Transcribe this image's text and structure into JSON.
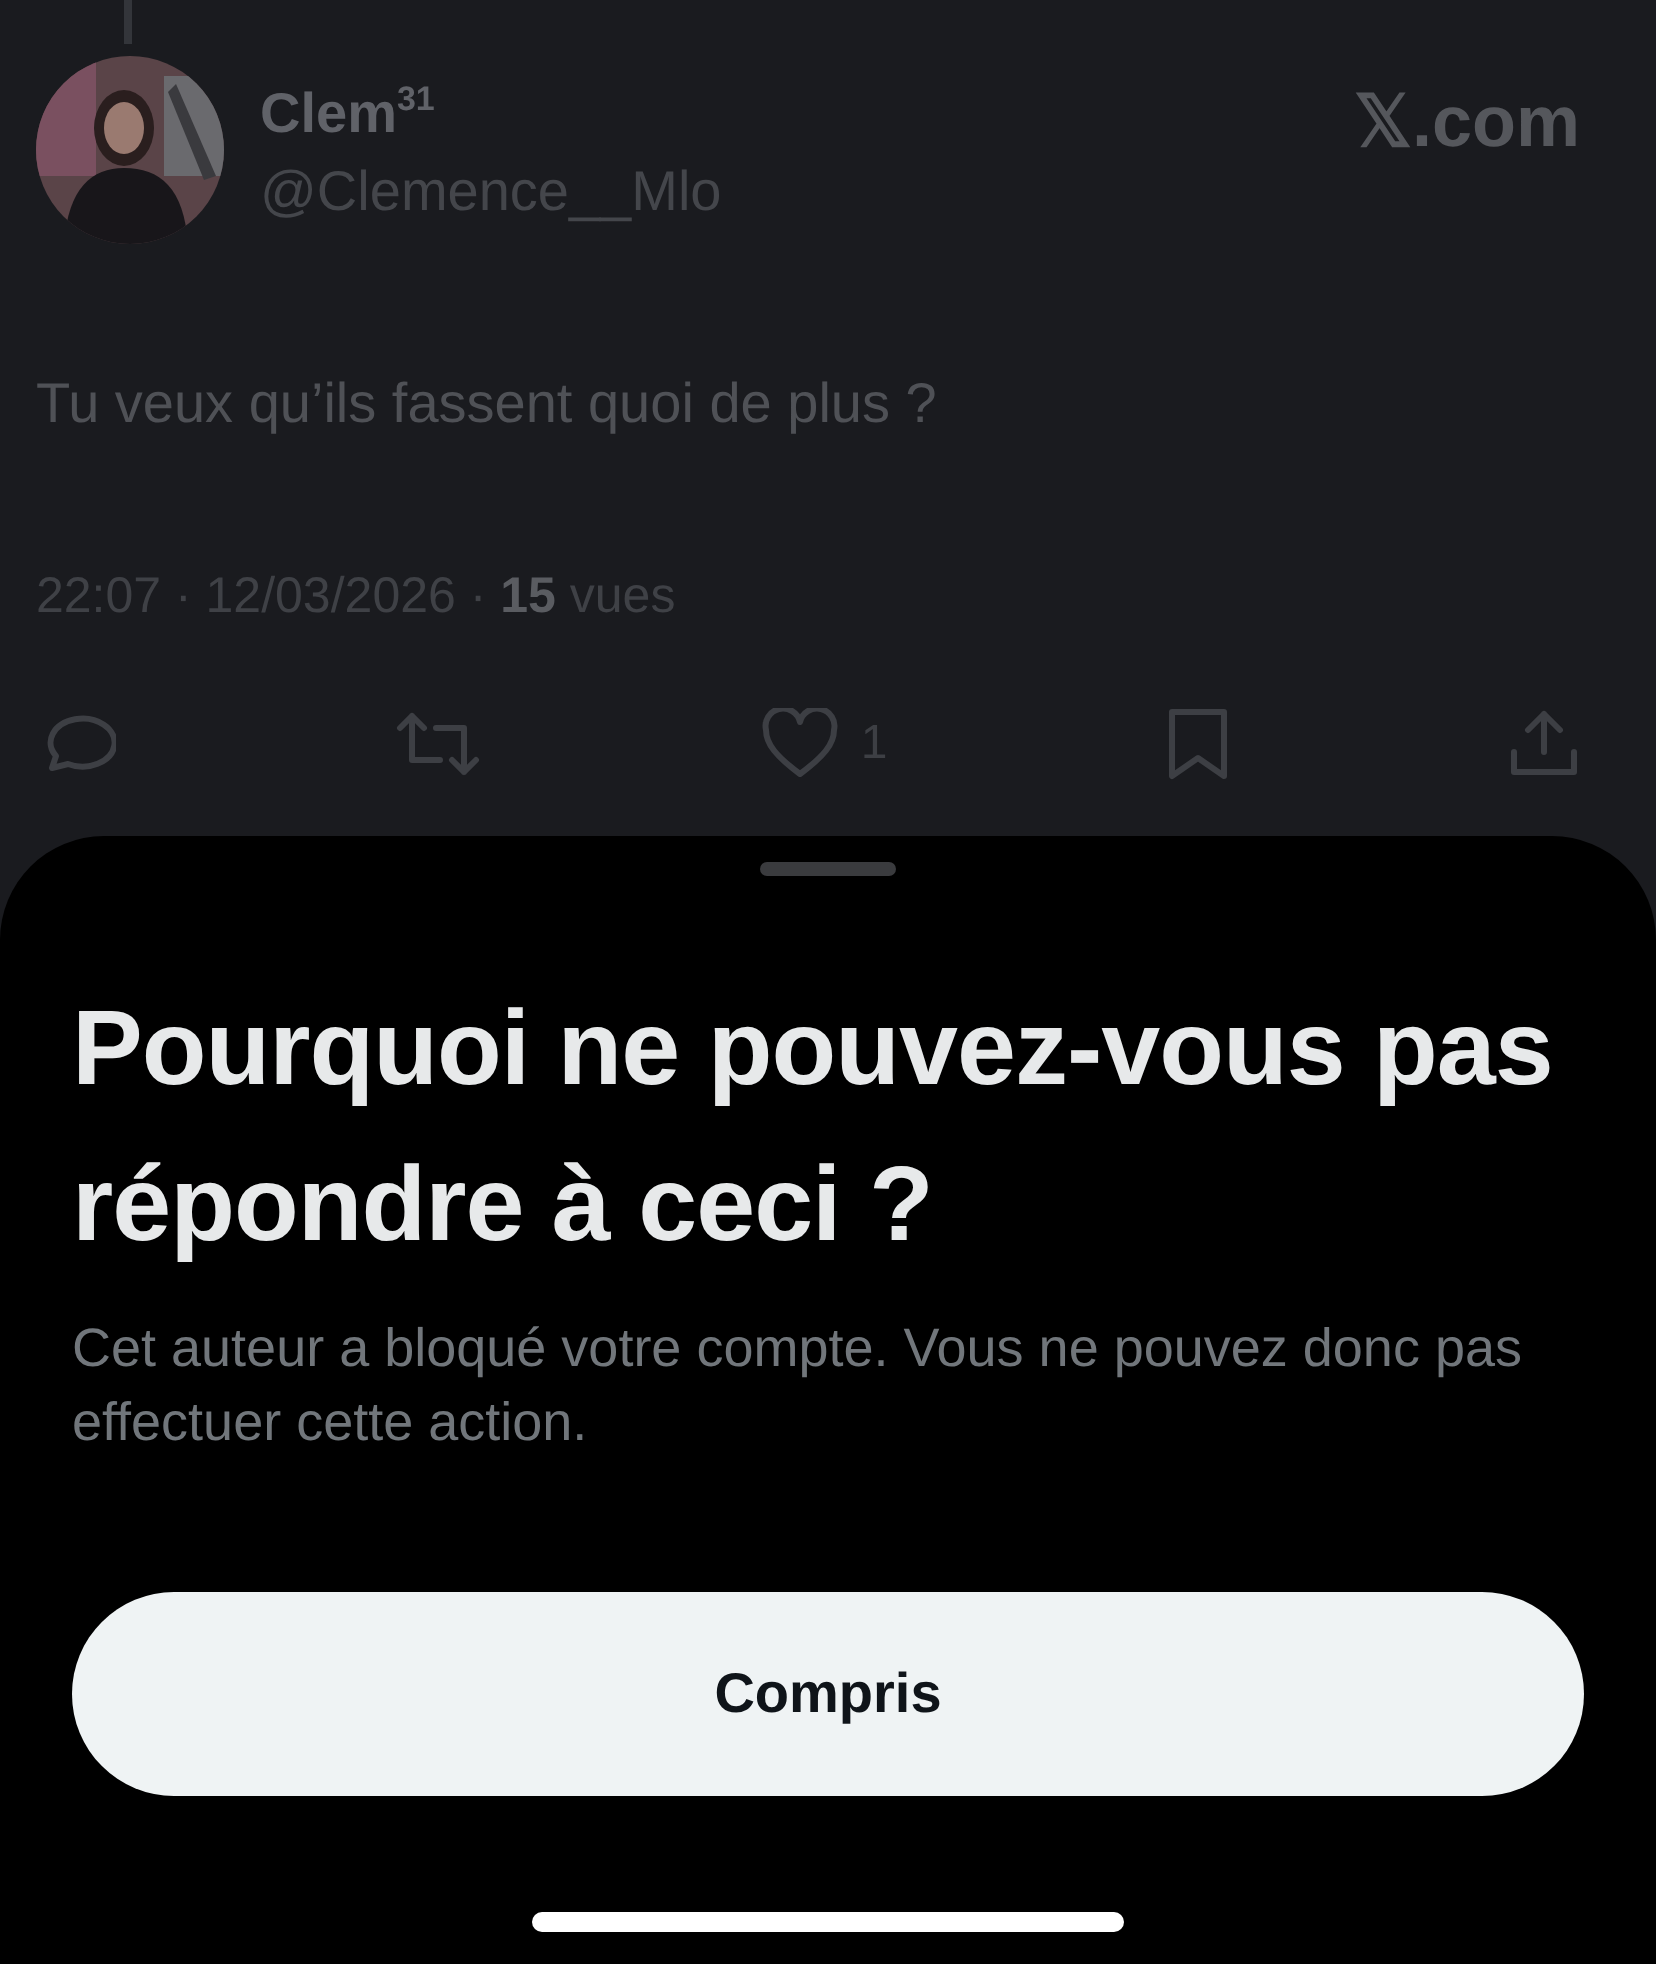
{
  "tweet": {
    "name": "Clem$^{31}$",
    "handle": "@Clemence__Mlo",
    "source": "𝕏.com",
    "text": "Tu veux qu’ils fassent quoi de plus ?",
    "meta": "22:07 · 12/03/2026 · **15** vues",
    "actions": [
      {
        "kind": "reply"
      },
      {
        "kind": "repost"
      },
      {
        "kind": "like",
        "count": "1"
      },
      {
        "kind": "bookmark"
      },
      {
        "kind": "share"
      }
    ]
  },
  "sheet": {
    "title": "Pourquoi ne pouvez-vous pas répondre à ceci ?",
    "body": "Cet auteur a bloqué votre compte. Vous ne pouvez donc pas effectuer cette action.",
    "button": "Compris"
  }
}
